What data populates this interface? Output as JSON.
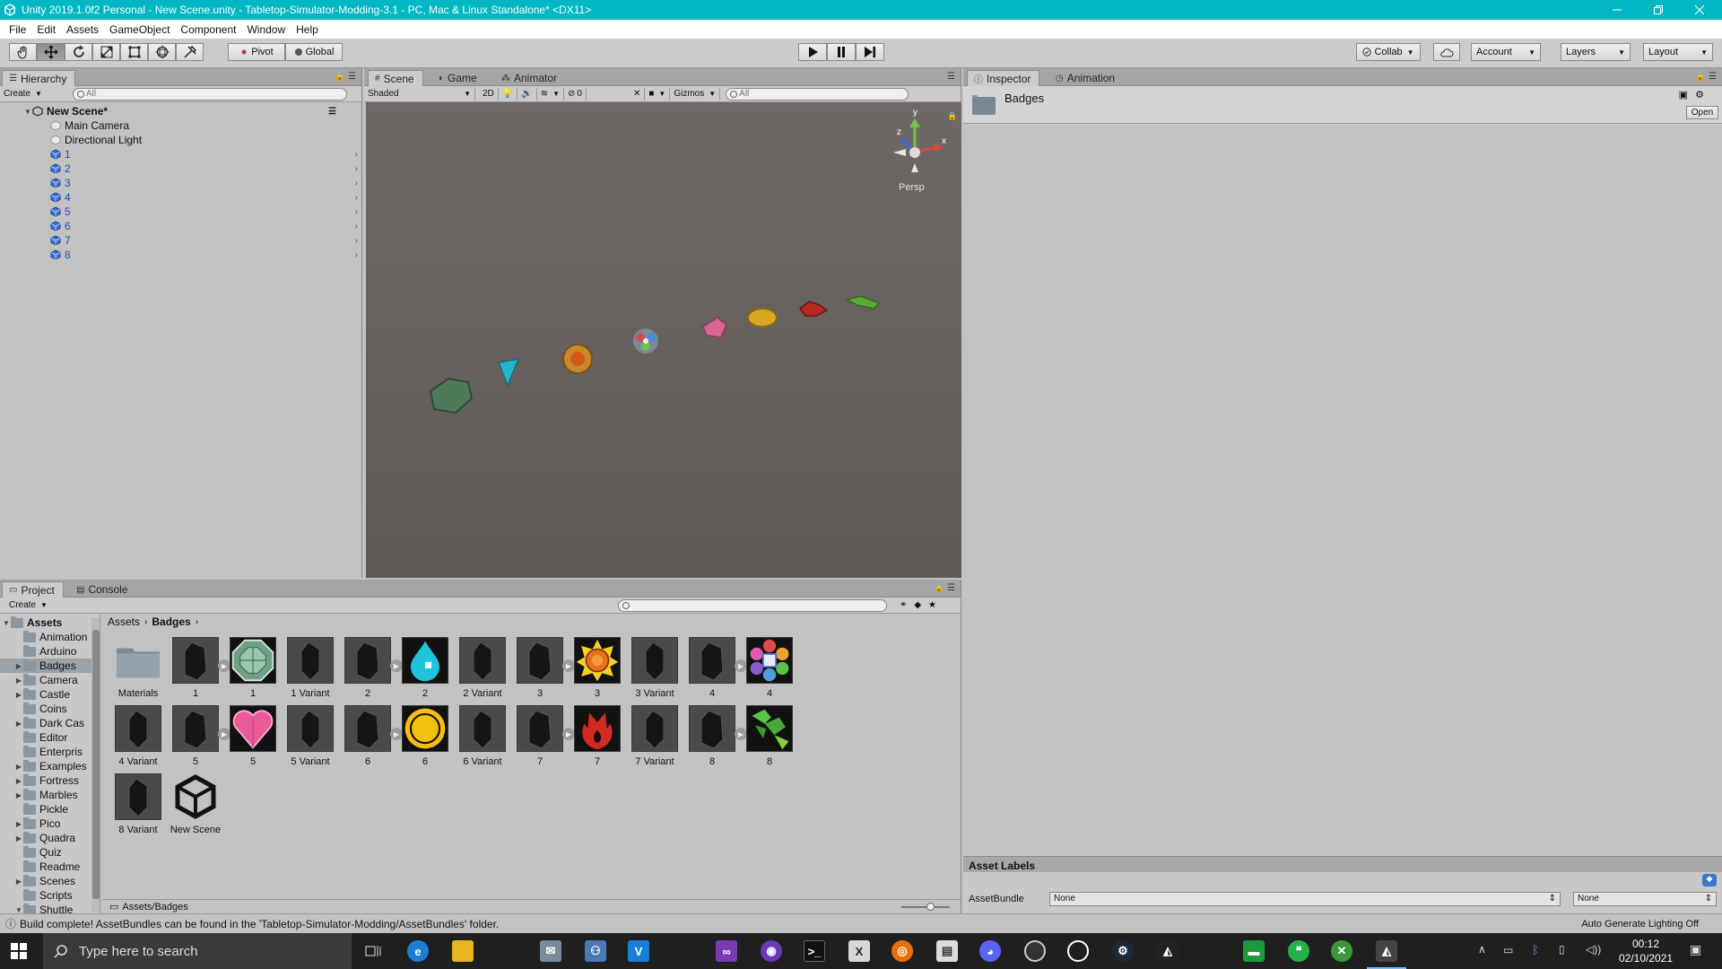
{
  "window": {
    "title": "Unity 2019.1.0f2 Personal - New Scene.unity - Tabletop-Simulator-Modding-3.1 - PC, Mac & Linux Standalone* <DX11>",
    "controls": [
      "minimize-icon",
      "restore-icon",
      "close-icon"
    ]
  },
  "menu": [
    "File",
    "Edit",
    "Assets",
    "GameObject",
    "Component",
    "Window",
    "Help"
  ],
  "toolbar": {
    "tools": [
      "hand-tool-icon",
      "move-tool-icon",
      "rotate-tool-icon",
      "scale-tool-icon",
      "rect-tool-icon",
      "transform-tool-icon",
      "custom-tool-icon"
    ],
    "pivot_label": "Pivot",
    "global_label": "Global",
    "collab_label": "Collab",
    "account_label": "Account",
    "layers_label": "Layers",
    "layout_label": "Layout"
  },
  "hierarchy": {
    "tab": "Hierarchy",
    "create_label": "Create",
    "search_placeholder": "All",
    "scene_name": "New Scene*",
    "items": [
      "Main Camera",
      "Directional Light",
      "1",
      "2",
      "3",
      "4",
      "5",
      "6",
      "7",
      "8"
    ]
  },
  "scene": {
    "tabs": [
      "Scene",
      "Game",
      "Animator"
    ],
    "shading_mode": "Shaded",
    "mode_2d": "2D",
    "hidden_count": "0",
    "gizmos_label": "Gizmos",
    "search_placeholder": "All",
    "gizmo_labels": {
      "y": "y",
      "x": "x",
      "z": "z"
    },
    "projection": "Persp"
  },
  "inspector": {
    "tabs": [
      "Inspector",
      "Animation"
    ],
    "object_name": "Badges",
    "open_label": "Open",
    "asset_labels_title": "Asset Labels",
    "assetbundle_label": "AssetBundle",
    "assetbundle_value": "None",
    "assetbundle_variant": "None"
  },
  "project": {
    "tabs": [
      "Project",
      "Console"
    ],
    "create_label": "Create",
    "root": "Assets",
    "folders": [
      "Animation",
      "Arduino",
      "Badges",
      "Camera",
      "Castle",
      "Coins",
      "Dark Cas",
      "Editor",
      "Enterpris",
      "Examples",
      "Fortress",
      "Marbles",
      "Pickle",
      "Pico",
      "Quadra",
      "Quiz",
      "Readme",
      "Scenes",
      "Scripts",
      "Shuttle"
    ],
    "selected_folder": "Badges",
    "breadcrumb": [
      "Assets",
      "Badges"
    ],
    "footer_path": "Assets/Badges",
    "assets": [
      {
        "label": "Materials",
        "kind": "folder"
      },
      {
        "label": "1",
        "kind": "prefab-model",
        "expandable": true
      },
      {
        "label": "1",
        "kind": "texture-green-octagon"
      },
      {
        "label": "1 Variant",
        "kind": "prefab-variant"
      },
      {
        "label": "2",
        "kind": "prefab-model",
        "expandable": true
      },
      {
        "label": "2",
        "kind": "texture-cyan-drop"
      },
      {
        "label": "2 Variant",
        "kind": "prefab-variant"
      },
      {
        "label": "3",
        "kind": "prefab-model",
        "expandable": true
      },
      {
        "label": "3",
        "kind": "texture-orange-sun"
      },
      {
        "label": "3 Variant",
        "kind": "prefab-variant"
      },
      {
        "label": "4",
        "kind": "prefab-model",
        "expandable": true
      },
      {
        "label": "4",
        "kind": "texture-rainbow-flower"
      },
      {
        "label": "4 Variant",
        "kind": "prefab-variant"
      },
      {
        "label": "5",
        "kind": "prefab-model",
        "expandable": true
      },
      {
        "label": "5",
        "kind": "texture-pink-heart"
      },
      {
        "label": "5 Variant",
        "kind": "prefab-variant"
      },
      {
        "label": "6",
        "kind": "prefab-model",
        "expandable": true
      },
      {
        "label": "6",
        "kind": "texture-gold-circle"
      },
      {
        "label": "6 Variant",
        "kind": "prefab-variant"
      },
      {
        "label": "7",
        "kind": "prefab-model",
        "expandable": true
      },
      {
        "label": "7",
        "kind": "texture-red-flame"
      },
      {
        "label": "7 Variant",
        "kind": "prefab-variant"
      },
      {
        "label": "8",
        "kind": "prefab-model",
        "expandable": true
      },
      {
        "label": "8",
        "kind": "texture-green-leaf"
      },
      {
        "label": "8 Variant",
        "kind": "prefab-variant"
      },
      {
        "label": "New Scene",
        "kind": "unity-scene"
      }
    ]
  },
  "status": {
    "message": "Build complete! AssetBundles can be found in the 'Tabletop-Simulator-Modding/AssetBundles' folder.",
    "lighting": "Auto Generate Lighting Off"
  },
  "taskbar": {
    "search_placeholder": "Type here to search",
    "time": "00:12",
    "date": "02/10/2021"
  },
  "colors": {
    "title_bar": "#00b7c3",
    "panel_bg": "#c2c2c2",
    "scene_bg": "#6b6561",
    "taskbar": "#1f1f1f",
    "hier_blue": "#1a4fc6"
  }
}
